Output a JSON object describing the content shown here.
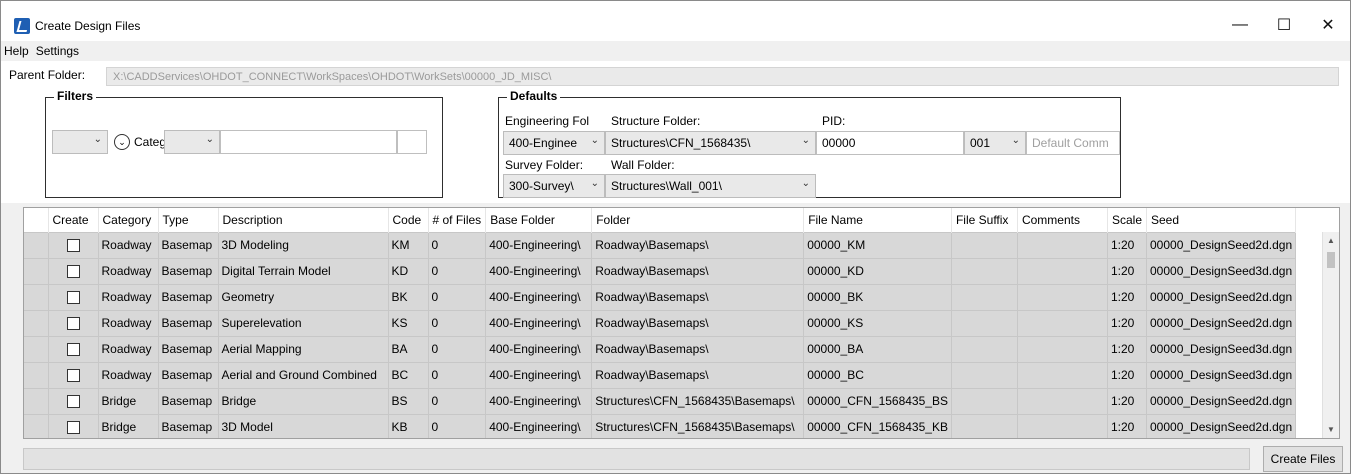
{
  "window": {
    "title": "Create Design Files",
    "minimize": "—",
    "maximize": "☐",
    "close": "✕"
  },
  "menu": [
    "Help",
    "Settings"
  ],
  "parent_folder": {
    "label": "Parent Folder:",
    "value": "X:\\CADDServices\\OHDOT_CONNECT\\WorkSpaces\\OHDOT\\WorkSets\\00000_JD_MISC\\"
  },
  "filters": {
    "title": "Filters",
    "category_label": "Categ"
  },
  "defaults": {
    "title": "Defaults",
    "engineering_folder_label": "Engineering Fol",
    "engineering_folder_value": "400-Enginee",
    "structure_folder_label": "Structure Folder:",
    "structure_folder_value": "Structures\\CFN_1568435\\",
    "pid_label": "PID:",
    "pid_value": "00000",
    "number_value": "001",
    "comment_placeholder": "Default Comm",
    "survey_folder_label": "Survey Folder:",
    "survey_folder_value": "300-Survey\\",
    "wall_folder_label": "Wall Folder:",
    "wall_folder_value": "Structures\\Wall_001\\"
  },
  "grid": {
    "columns": [
      "Create",
      "Category",
      "Type",
      "Description",
      "Code",
      "# of Files",
      "Base Folder",
      "Folder",
      "File Name",
      "File Suffix",
      "Comments",
      "Scale",
      "Seed"
    ],
    "rows": [
      {
        "category": "Roadway",
        "type": "Basemap",
        "description": "3D Modeling",
        "code": "KM",
        "files": "0",
        "base": "400-Engineering\\",
        "folder": "Roadway\\Basemaps\\",
        "file": "00000_KM",
        "suffix": "",
        "comments": "",
        "scale": "1:20",
        "seed": "00000_DesignSeed2d.dgn"
      },
      {
        "category": "Roadway",
        "type": "Basemap",
        "description": "Digital Terrain Model",
        "code": "KD",
        "files": "0",
        "base": "400-Engineering\\",
        "folder": "Roadway\\Basemaps\\",
        "file": "00000_KD",
        "suffix": "",
        "comments": "",
        "scale": "1:20",
        "seed": "00000_DesignSeed3d.dgn"
      },
      {
        "category": "Roadway",
        "type": "Basemap",
        "description": "Geometry",
        "code": "BK",
        "files": "0",
        "base": "400-Engineering\\",
        "folder": "Roadway\\Basemaps\\",
        "file": "00000_BK",
        "suffix": "",
        "comments": "",
        "scale": "1:20",
        "seed": "00000_DesignSeed2d.dgn"
      },
      {
        "category": "Roadway",
        "type": "Basemap",
        "description": "Superelevation",
        "code": "KS",
        "files": "0",
        "base": "400-Engineering\\",
        "folder": "Roadway\\Basemaps\\",
        "file": "00000_KS",
        "suffix": "",
        "comments": "",
        "scale": "1:20",
        "seed": "00000_DesignSeed2d.dgn"
      },
      {
        "category": "Roadway",
        "type": "Basemap",
        "description": "Aerial Mapping",
        "code": "BA",
        "files": "0",
        "base": "400-Engineering\\",
        "folder": "Roadway\\Basemaps\\",
        "file": "00000_BA",
        "suffix": "",
        "comments": "",
        "scale": "1:20",
        "seed": "00000_DesignSeed3d.dgn"
      },
      {
        "category": "Roadway",
        "type": "Basemap",
        "description": "Aerial and Ground Combined",
        "code": "BC",
        "files": "0",
        "base": "400-Engineering\\",
        "folder": "Roadway\\Basemaps\\",
        "file": "00000_BC",
        "suffix": "",
        "comments": "",
        "scale": "1:20",
        "seed": "00000_DesignSeed3d.dgn"
      },
      {
        "category": "Bridge",
        "type": "Basemap",
        "description": "Bridge",
        "code": "BS",
        "files": "0",
        "base": "400-Engineering\\",
        "folder": "Structures\\CFN_1568435\\Basemaps\\",
        "file": "00000_CFN_1568435_BS",
        "suffix": "",
        "comments": "",
        "scale": "1:20",
        "seed": "00000_DesignSeed2d.dgn"
      },
      {
        "category": "Bridge",
        "type": "Basemap",
        "description": "3D Model",
        "code": "KB",
        "files": "0",
        "base": "400-Engineering\\",
        "folder": "Structures\\CFN_1568435\\Basemaps\\",
        "file": "00000_CFN_1568435_KB",
        "suffix": "",
        "comments": "",
        "scale": "1:20",
        "seed": "00000_DesignSeed2d.dgn"
      }
    ]
  },
  "create_button": "Create Files"
}
